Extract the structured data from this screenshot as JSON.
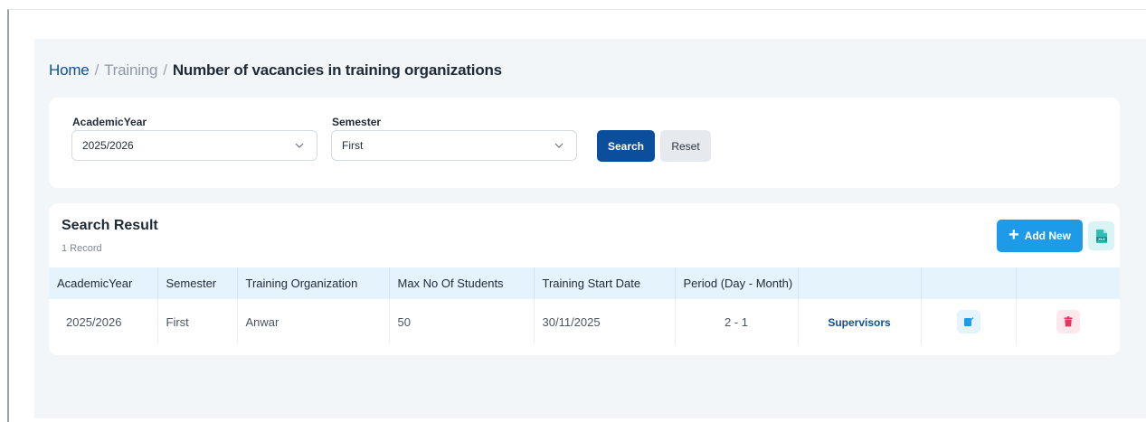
{
  "breadcrumb": {
    "home": "Home",
    "section": "Training",
    "current": "Number of vacancies in training organizations",
    "separator": "/"
  },
  "filters": {
    "academic_year_label": "AcademicYear",
    "academic_year_value": "2025/2026",
    "semester_label": "Semester",
    "semester_value": "First",
    "search_label": "Search",
    "reset_label": "Reset"
  },
  "results": {
    "title": "Search Result",
    "count": "1 Record",
    "add_new_label": "Add New",
    "add_icon": "+",
    "export_icon_text": "XLS",
    "columns": [
      "AcademicYear",
      "Semester",
      "Training Organization",
      "Max No Of Students",
      "Training Start Date",
      "Period (Day - Month)",
      "",
      "",
      ""
    ],
    "rows": [
      {
        "academic_year": "2025/2026",
        "semester": "First",
        "organization": "Anwar",
        "max_students": "50",
        "start_date": "30/11/2025",
        "period": "2 - 1",
        "supervisors_label": "Supervisors"
      }
    ]
  },
  "colors": {
    "primary": "#0b4f9c",
    "accent": "#1e9be8",
    "header_bg": "#e5f3fd",
    "delete": "#e8345f",
    "export": "#2fbfb8"
  },
  "icons": {
    "dropdown": "chevron-down-icon",
    "add": "plus-icon",
    "export": "excel-export-icon",
    "edit": "edit-icon",
    "delete": "trash-icon"
  }
}
